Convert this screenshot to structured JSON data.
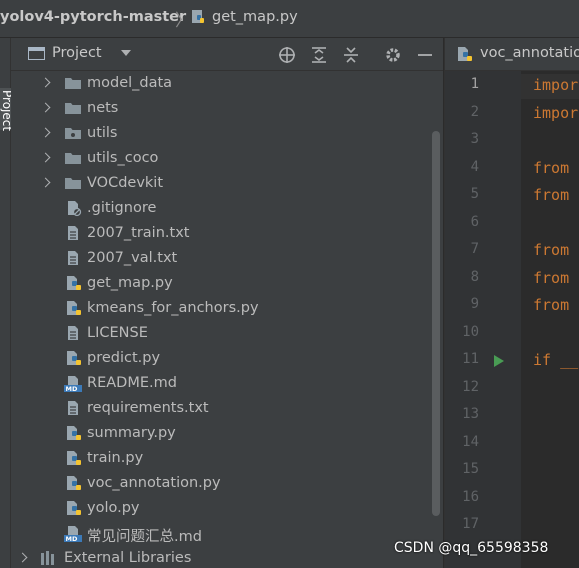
{
  "breadcrumb": {
    "project": "yolov4-pytorch-master",
    "separator": "〉",
    "file": "get_map.py"
  },
  "sidebar_strip": {
    "label": "Project"
  },
  "project_panel": {
    "title": "Project",
    "toolbar_icons": [
      "locate-icon",
      "expand-all-icon",
      "collapse-all-icon",
      "settings-icon",
      "hide-icon"
    ]
  },
  "tree": {
    "items": [
      {
        "label": "model_data",
        "kind": "folder"
      },
      {
        "label": "nets",
        "kind": "folder"
      },
      {
        "label": "utils",
        "kind": "folder"
      },
      {
        "label": "utils_coco",
        "kind": "folder"
      },
      {
        "label": "VOCdevkit",
        "kind": "folder"
      },
      {
        "label": ".gitignore",
        "kind": "ignore-file"
      },
      {
        "label": "2007_train.txt",
        "kind": "text-file"
      },
      {
        "label": "2007_val.txt",
        "kind": "text-file"
      },
      {
        "label": "get_map.py",
        "kind": "python-file"
      },
      {
        "label": "kmeans_for_anchors.py",
        "kind": "python-file"
      },
      {
        "label": "LICENSE",
        "kind": "text-file"
      },
      {
        "label": "predict.py",
        "kind": "python-file"
      },
      {
        "label": "README.md",
        "kind": "markdown-file"
      },
      {
        "label": "requirements.txt",
        "kind": "text-file"
      },
      {
        "label": "summary.py",
        "kind": "python-file"
      },
      {
        "label": "train.py",
        "kind": "python-file"
      },
      {
        "label": "voc_annotation.py",
        "kind": "python-file"
      },
      {
        "label": "yolo.py",
        "kind": "python-file"
      },
      {
        "label": "常见问题汇总.md",
        "kind": "markdown-file"
      },
      {
        "label": "External Libraries",
        "kind": "library"
      }
    ]
  },
  "editor": {
    "tab_label": "voc_annotatio",
    "current_line": 1,
    "line_numbers": [
      "1",
      "2",
      "3",
      "4",
      "5",
      "6",
      "7",
      "8",
      "9",
      "10",
      "11",
      "12",
      "13",
      "14",
      "15",
      "16",
      "17"
    ],
    "code_lines": [
      "impor",
      "impor",
      "",
      "from",
      "from",
      "",
      "from",
      "from",
      "from",
      "",
      "if __",
      "",
      "",
      "",
      "",
      "",
      ""
    ]
  },
  "watermark": "CSDN @qq_65598358",
  "colors": {
    "accent": "#499c54",
    "keyword": "#cc7832",
    "panel": "#3c3f41",
    "editor_bg": "#2b2b2b"
  }
}
